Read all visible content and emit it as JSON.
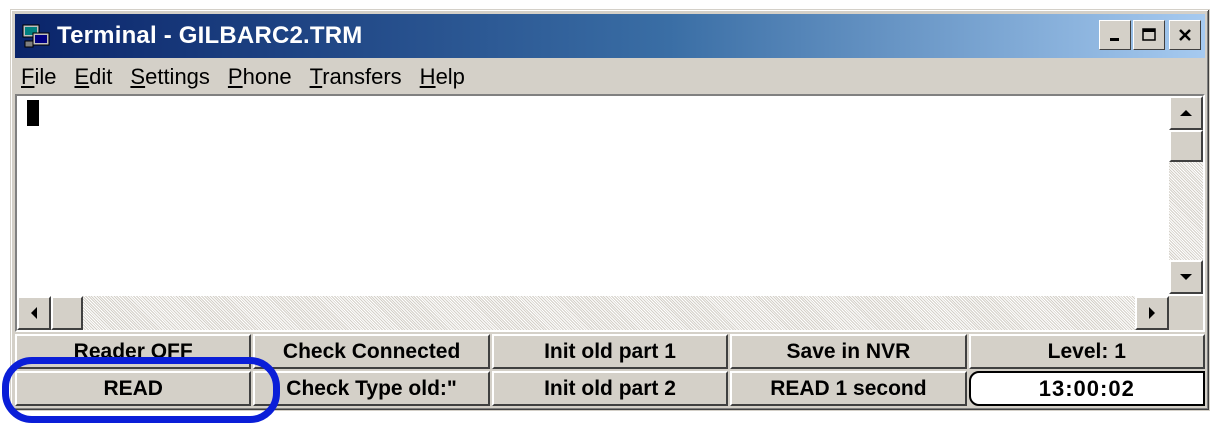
{
  "window": {
    "title": "Terminal - GILBARC2.TRM",
    "icon": "terminal-app-icon",
    "controls": [
      "minimize",
      "maximize",
      "close"
    ]
  },
  "menu": {
    "items": [
      {
        "pre": "",
        "u": "F",
        "post": "ile"
      },
      {
        "pre": "",
        "u": "E",
        "post": "dit"
      },
      {
        "pre": "",
        "u": "S",
        "post": "ettings"
      },
      {
        "pre": "",
        "u": "P",
        "post": "hone"
      },
      {
        "pre": "",
        "u": "T",
        "post": "ransfers"
      },
      {
        "pre": "",
        "u": "H",
        "post": "elp"
      }
    ]
  },
  "terminal": {
    "content": ""
  },
  "function_keys": {
    "row1": [
      "Reader OFF",
      "Check Connected",
      "Init old part 1",
      "Save in NVR",
      "Level: 1"
    ],
    "row2": [
      "READ",
      "Check Type old:\"",
      "Init old part 2",
      "READ 1 second"
    ],
    "clock": "13:00:02"
  },
  "colors": {
    "title_gradient_start": "#0a246a",
    "title_gradient_end": "#a6caf0",
    "face": "#d4d0c8",
    "highlight_ring": "#0a1ed8"
  }
}
